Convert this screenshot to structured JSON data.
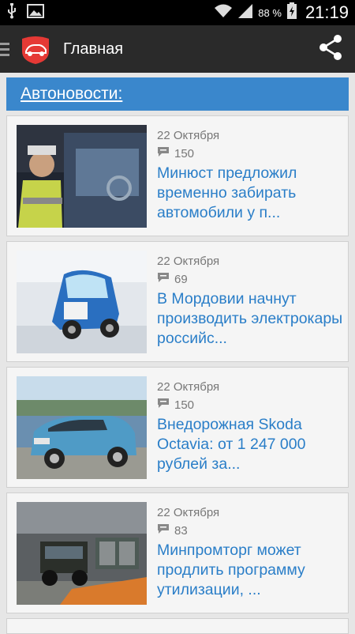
{
  "status_bar": {
    "battery": "88 %",
    "time": "21:19",
    "icons": [
      "usb-icon",
      "image-icon",
      "wifi-icon",
      "signal-icon",
      "battery-charging-icon"
    ]
  },
  "action_bar": {
    "title": "Главная",
    "logo": "car-logo-icon",
    "share": "share-icon"
  },
  "section": {
    "title": "Автоновости:"
  },
  "news": [
    {
      "date": "22 Октября",
      "comments": "150",
      "title": "Минюст предложил временно забирать автомобили у п..."
    },
    {
      "date": "22 Октября",
      "comments": "69",
      "title": "В Мордовии начнут производить электрокары российс..."
    },
    {
      "date": "22 Октября",
      "comments": "150",
      "title": "Внедорожная Skoda Octavia: от 1 247 000 рублей за..."
    },
    {
      "date": "22 Октября",
      "comments": "83",
      "title": "Минпромторг может продлить программу утилизации, ..."
    }
  ],
  "colors": {
    "accent": "#3a87cc",
    "title_link": "#2a7ec8",
    "action_bar": "#2a2a2a",
    "logo": "#e53935"
  }
}
